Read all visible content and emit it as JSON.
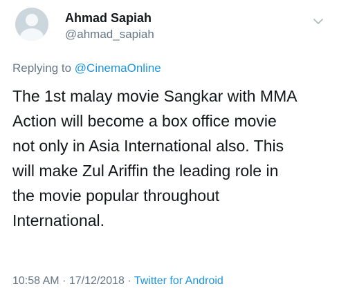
{
  "tweet": {
    "display_name": "Ahmad Sapiah",
    "handle": "@ahmad_sapiah",
    "replying_to_prefix": "Replying to ",
    "replying_to_handle": "@CinemaOnline",
    "text_lines": [
      "The 1st malay movie Sangkar with MMA",
      "Action will become a box office movie",
      "not only in Asia International also. This",
      "will make Zul Ariffin the leading role in",
      "the movie popular throughout",
      "International."
    ],
    "time": "10:58 AM",
    "date": "17/12/2018",
    "separator": "·",
    "source_app": "Twitter for Android"
  },
  "icons": {
    "avatar": "default-avatar",
    "menu": "chevron-down-icon"
  },
  "colors": {
    "link": "#1b95e0",
    "secondary_text": "#657786",
    "primary_text": "#14171a"
  }
}
